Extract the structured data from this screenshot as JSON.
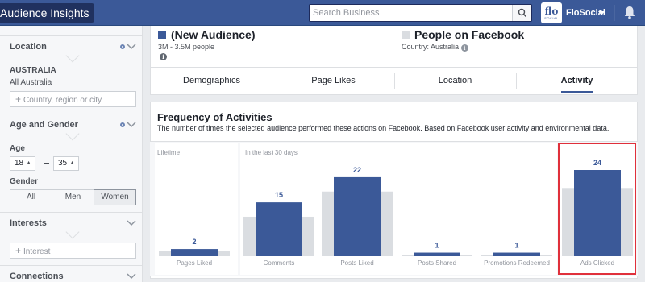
{
  "topbar": {
    "app_title": "Audience Insights",
    "search_placeholder": "Search Business",
    "brand_logo_line1": "flo",
    "brand_logo_line2": "SOCIAL",
    "account_name": "FloSocial"
  },
  "sidebar": {
    "location": {
      "heading": "Location",
      "country": "AUSTRALIA",
      "region": "All Australia",
      "input_placeholder": "Country, region or city"
    },
    "age_gender": {
      "heading": "Age and Gender",
      "age_label": "Age",
      "age_min": "18",
      "age_max": "35",
      "gender_label": "Gender",
      "genders": [
        "All",
        "Men",
        "Women"
      ],
      "selected_gender": "Women"
    },
    "interests": {
      "heading": "Interests",
      "input_placeholder": "Interest"
    },
    "connections": {
      "heading": "Connections"
    }
  },
  "audience": {
    "name": "(New Audience)",
    "size": "3M - 3.5M people",
    "color": "#3b5998"
  },
  "comparison": {
    "name": "People on Facebook",
    "country": "Country: Australia",
    "color": "#dadde1"
  },
  "tabs": [
    "Demographics",
    "Page Likes",
    "Location",
    "Activity"
  ],
  "active_tab": "Activity",
  "section": {
    "title": "Frequency of Activities",
    "description": "The number of times the selected audience performed these actions on Facebook. Based on Facebook user activity and environmental data."
  },
  "chart_data": {
    "type": "bar",
    "groups": [
      {
        "label": "Lifetime",
        "categories": [
          "Pages Liked"
        ]
      },
      {
        "label": "In the last 30 days",
        "categories": [
          "Comments",
          "Posts Liked",
          "Posts Shared",
          "Promotions Redeemed",
          "Ads Clicked"
        ]
      }
    ],
    "categories": [
      "Pages Liked",
      "Comments",
      "Posts Liked",
      "Posts Shared",
      "Promotions Redeemed",
      "Ads Clicked"
    ],
    "series": [
      {
        "name": "(New Audience)",
        "values": [
          2,
          15,
          22,
          1,
          1,
          24
        ],
        "color": "#3b5998"
      },
      {
        "name": "People on Facebook",
        "values": [
          1.5,
          11,
          18,
          0.3,
          0.3,
          19
        ],
        "color": "#dadde1"
      }
    ],
    "data_labels": [
      "2",
      "15",
      "22",
      "1",
      "1",
      "24"
    ],
    "highlighted_category": "Ads Clicked",
    "highlight_color": "#e0303b"
  }
}
